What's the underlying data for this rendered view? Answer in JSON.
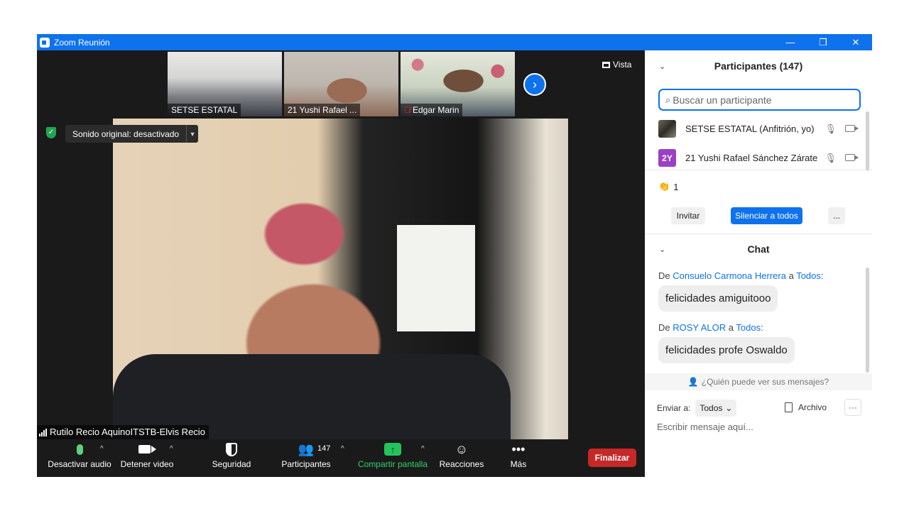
{
  "window": {
    "title": "Zoom Reunión",
    "controls": [
      "—",
      "❐",
      "✕"
    ]
  },
  "meeting": {
    "view_label": "Vista",
    "thumbnails": [
      {
        "name": "SETSE ESTATAL",
        "muted": false
      },
      {
        "name": "21 Yushi Rafael ...",
        "muted": false
      },
      {
        "name": "Edgar Marin",
        "muted": true
      }
    ],
    "sound_label": "Sonido original: desactivado",
    "speaker_name": "Rutilo Recio AquinoITSTB-Elvis Recio"
  },
  "toolbar": {
    "audio": "Desactivar audio",
    "video": "Detener video",
    "security": "Seguridad",
    "participants": "Participantes",
    "participants_count": "147",
    "share": "Compartir pantalla",
    "reactions": "Reacciones",
    "more": "Más",
    "end": "Finalizar"
  },
  "participants_panel": {
    "title": "Participantes (147)",
    "search_placeholder": "Buscar un participante",
    "list": [
      {
        "name": "SETSE ESTATAL (Anfitrión, yo)",
        "avatar": ""
      },
      {
        "name": "21 Yushi Rafael Sánchez Zárate",
        "avatar": "2Y"
      }
    ],
    "raised_hands": "1",
    "buttons": {
      "invite": "Invitar",
      "mute_all": "Silenciar a todos",
      "more": "..."
    }
  },
  "chat": {
    "title": "Chat",
    "messages": [
      {
        "prefix": "De",
        "from": "Consuelo Carmona Herrera",
        "connector": "a",
        "to": "Todos",
        "suffix": ":",
        "text": "felicidades amiguitooo"
      },
      {
        "prefix": "De",
        "from": "ROSY ALOR",
        "connector": "a",
        "to": "Todos",
        "suffix": ":",
        "text": "felicidades profe Oswaldo"
      }
    ],
    "who_sees": "¿Quién puede ver sus mensajes?",
    "send_to_label": "Enviar a:",
    "send_to_value": "Todos",
    "file_label": "Archivo",
    "more": "···",
    "compose_placeholder": "Escribir mensaje aquí..."
  },
  "colors": {
    "accent": "#0e72ed",
    "end": "#c52827",
    "share": "#23c45b",
    "dark_bg": "#1a1a1a"
  }
}
